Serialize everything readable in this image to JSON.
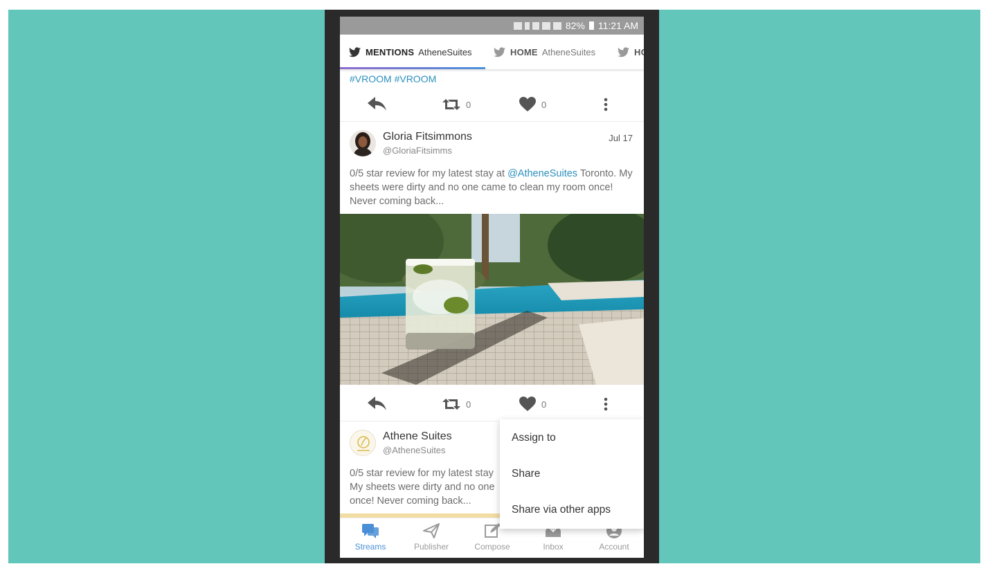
{
  "status": {
    "battery": "82%",
    "time": "11:21 AM"
  },
  "tabs": [
    {
      "name": "MENTIONS",
      "account": "AtheneSuites"
    },
    {
      "name": "HOME",
      "account": "AtheneSuites"
    },
    {
      "name": "HO",
      "account": ""
    }
  ],
  "post0": {
    "hashtags": "#VROOM #VROOM",
    "retweet_count": "0",
    "like_count": "0"
  },
  "post1": {
    "name": "Gloria Fitsimmons",
    "handle": "@GloriaFitsimms",
    "date": "Jul 17",
    "text_before": "0/5 star review for my latest stay at ",
    "mention": "@AtheneSuites",
    "text_after": " Toronto. My sheets were dirty and no one came to clean my room once! Never coming back...",
    "retweet_count": "0",
    "like_count": "0"
  },
  "post2": {
    "name": "Athene Suites",
    "handle": "@AtheneSuites",
    "line1": "0/5 star review for my latest stay",
    "line2": "My sheets were dirty and no one",
    "line3": "once! Never coming back..."
  },
  "menu": {
    "items": [
      "Assign to",
      "Share",
      "Share via other apps"
    ]
  },
  "nav": {
    "items": [
      "Streams",
      "Publisher",
      "Compose",
      "Inbox",
      "Account"
    ]
  },
  "colors": {
    "background": "#63c6bb",
    "accent": "#4a8fd6",
    "link": "#2a8fbd"
  }
}
